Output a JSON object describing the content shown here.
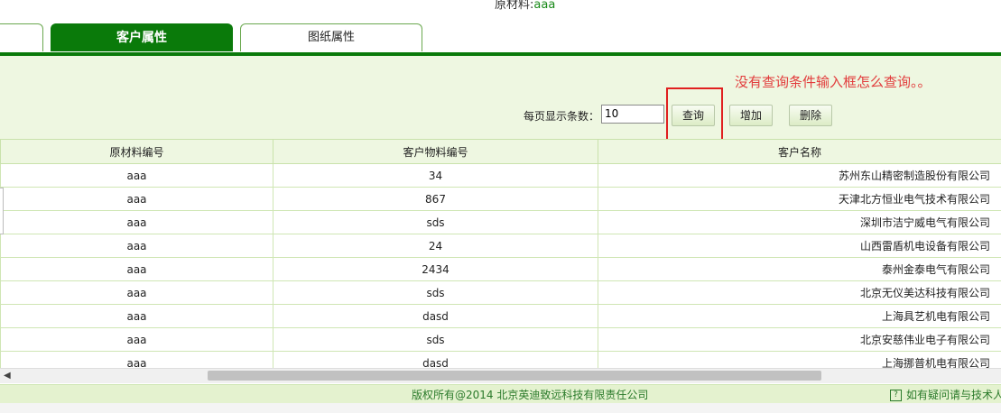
{
  "header": {
    "material_label": "原材料:",
    "material_value": "aaa"
  },
  "tabs": [
    {
      "label": ""
    },
    {
      "label": "客户属性",
      "active": true
    },
    {
      "label": "图纸属性"
    }
  ],
  "annotation": "没有查询条件输入框怎么查询。。",
  "toolbar": {
    "per_page_label": "每页显示条数：",
    "per_page_value": "10",
    "query_label": "查询",
    "add_label": "增加",
    "delete_label": "删除"
  },
  "table": {
    "columns": [
      "原材料编号",
      "客户物料编号",
      "客户名称"
    ],
    "rows": [
      [
        "aaa",
        "34",
        "苏州东山精密制造股份有限公司"
      ],
      [
        "aaa",
        "867",
        "天津北方恒业电气技术有限公司"
      ],
      [
        "aaa",
        "sds",
        "深圳市洁宁威电气有限公司"
      ],
      [
        "aaa",
        "24",
        "山西雷盾机电设备有限公司"
      ],
      [
        "aaa",
        "2434",
        "泰州金泰电气有限公司"
      ],
      [
        "aaa",
        "sds",
        "北京无仪美达科技有限公司"
      ],
      [
        "aaa",
        "dasd",
        "上海具艺机电有限公司"
      ],
      [
        "aaa",
        "sds",
        "北京安慈伟业电子有限公司"
      ],
      [
        "aaa",
        "dasd",
        "上海挪普机电有限公司"
      ]
    ]
  },
  "footer": {
    "copyright": "版权所有@2014  北京英迪致远科技有限责任公司",
    "help": "如有疑问请与技术人"
  },
  "colors": {
    "accent": "#0a7a0a",
    "annotation": "#e23c3c",
    "panel": "#eef7e1"
  }
}
